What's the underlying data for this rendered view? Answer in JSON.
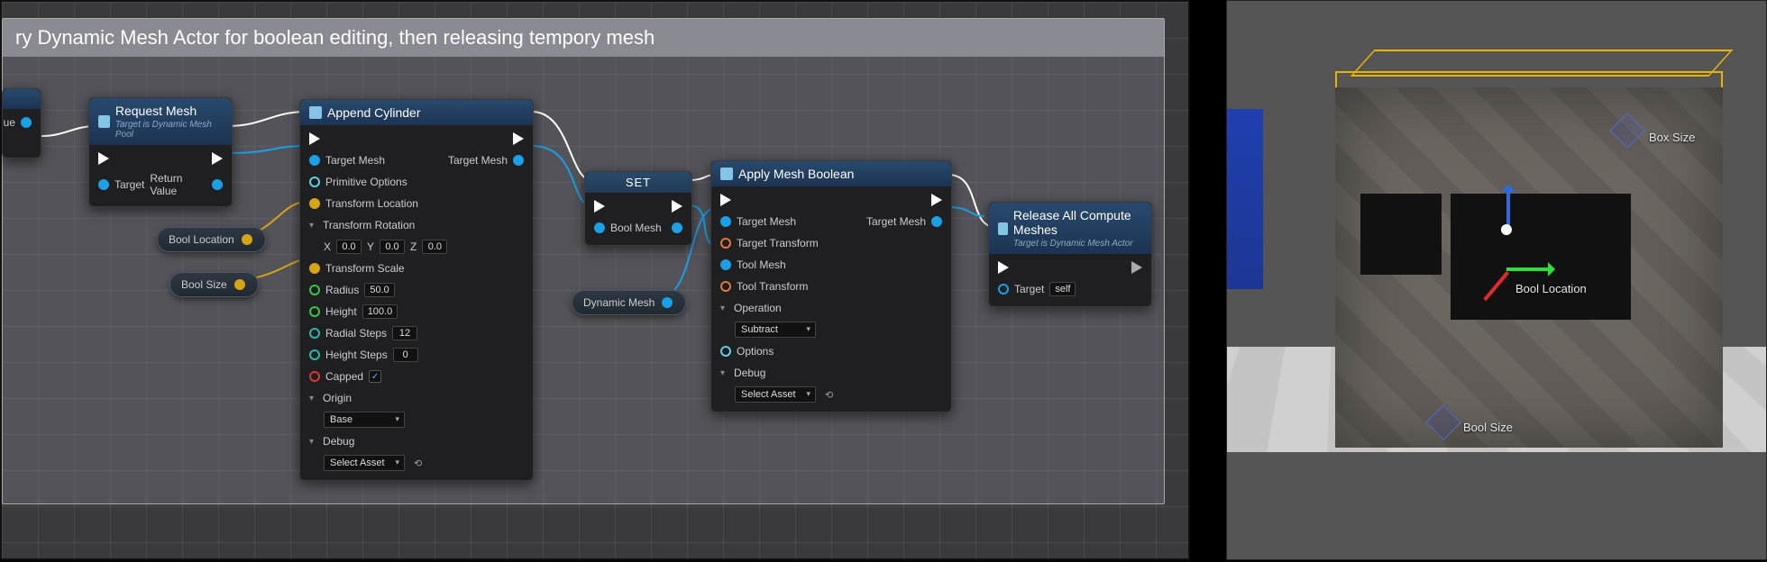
{
  "comment": {
    "title": "ry Dynamic Mesh Actor for boolean editing, then releasing tempory mesh"
  },
  "vars": {
    "bool_location": "Bool Location",
    "bool_size": "Bool Size"
  },
  "nodes": {
    "entry": {
      "pin_out": "ue"
    },
    "request_mesh": {
      "title": "Request Mesh",
      "subtitle": "Target is Dynamic Mesh Pool",
      "target": "Target",
      "return": "Return Value"
    },
    "append_cylinder": {
      "title": "Append Cylinder",
      "target_mesh": "Target Mesh",
      "target_mesh_out": "Target Mesh",
      "primitive_options": "Primitive Options",
      "transform_location": "Transform Location",
      "transform_rotation": "Transform Rotation",
      "rot_x_label": "X",
      "rot_x": "0.0",
      "rot_y_label": "Y",
      "rot_y": "0.0",
      "rot_z_label": "Z",
      "rot_z": "0.0",
      "transform_scale": "Transform Scale",
      "radius_label": "Radius",
      "radius": "50.0",
      "height_label": "Height",
      "height": "100.0",
      "radial_steps_label": "Radial Steps",
      "radial_steps": "12",
      "height_steps_label": "Height Steps",
      "height_steps": "0",
      "capped_label": "Capped",
      "capped": "✓",
      "origin_label": "Origin",
      "origin": "Base",
      "debug_label": "Debug",
      "debug": "Select Asset"
    },
    "set": {
      "title": "SET",
      "bool_mesh": "Bool Mesh"
    },
    "dyn_mesh": {
      "label": "Dynamic Mesh"
    },
    "apply_boolean": {
      "title": "Apply Mesh Boolean",
      "target_mesh": "Target Mesh",
      "target_mesh_out": "Target Mesh",
      "target_transform": "Target Transform",
      "tool_mesh": "Tool Mesh",
      "tool_transform": "Tool Transform",
      "operation_label": "Operation",
      "operation": "Subtract",
      "options": "Options",
      "debug_label": "Debug",
      "debug": "Select Asset"
    },
    "release": {
      "title": "Release All Compute Meshes",
      "subtitle": "Target is Dynamic Mesh Actor",
      "target": "Target",
      "self": "self"
    }
  },
  "viewport": {
    "box_size": "Box Size",
    "bool_location": "Bool Location",
    "bool_size": "Bool Size"
  }
}
